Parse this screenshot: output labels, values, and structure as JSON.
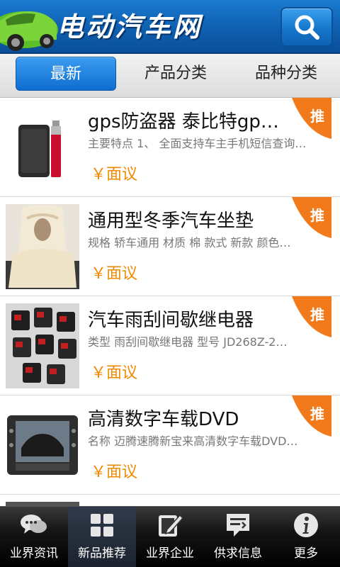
{
  "header": {
    "title": "电动汽车网",
    "search_icon": "search-icon",
    "logo_icon": "green-car-logo"
  },
  "tabs": [
    {
      "label": "最新",
      "active": true
    },
    {
      "label": "产品分类",
      "active": false
    },
    {
      "label": "品种分类",
      "active": false
    }
  ],
  "items": [
    {
      "title": "gps防盗器 泰比特gp…",
      "desc": "主要特点 1、 全面支持车主手机短信查询…",
      "price": "￥面议",
      "badge": "推",
      "thumb": "gps-device-image"
    },
    {
      "title": "通用型冬季汽车坐垫",
      "desc": "规格 轿车通用 材质 棉 款式 新款 颜色…",
      "price": "￥面议",
      "badge": "推",
      "thumb": "seat-cushion-image"
    },
    {
      "title": "汽车雨刮间歇继电器",
      "desc": "类型 雨刮间歇继电器 型号 JD268Z-2…",
      "price": "￥面议",
      "badge": "推",
      "thumb": "relay-image"
    },
    {
      "title": "高清数字车载DVD",
      "desc": "名称 迈腾速腾新宝来高清数字车载DVD…",
      "price": "￥面议",
      "badge": "推",
      "thumb": "car-dvd-image"
    }
  ],
  "nav": [
    {
      "label": "业界资讯",
      "icon": "chat-bubbles-icon",
      "active": false
    },
    {
      "label": "新品推荐",
      "icon": "grid-icon",
      "active": true
    },
    {
      "label": "业界企业",
      "icon": "edit-note-icon",
      "active": false
    },
    {
      "label": "供求信息",
      "icon": "message-icon",
      "active": false
    },
    {
      "label": "更多",
      "icon": "info-icon",
      "active": false
    }
  ],
  "colors": {
    "header_blue": "#0f5fb0",
    "badge_orange": "#f27a1a",
    "price_orange": "#f08a00"
  }
}
